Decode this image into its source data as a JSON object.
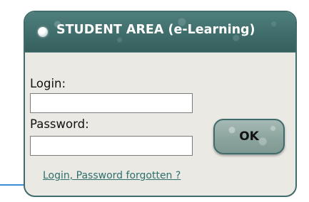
{
  "panel": {
    "title": "STUDENT AREA (e-Learning)"
  },
  "form": {
    "login_label": "Login:",
    "login_value": "",
    "password_label": "Password:",
    "password_value": "",
    "submit_label": "OK",
    "forgot_link": "Login, Password forgotten ?"
  },
  "colors": {
    "header": "#3f6d6b",
    "panel_background": "#ebe9e4",
    "link": "#2f6f6c",
    "button": "#8aa39d"
  },
  "icons": {
    "header_bullet": "bullet-icon"
  }
}
